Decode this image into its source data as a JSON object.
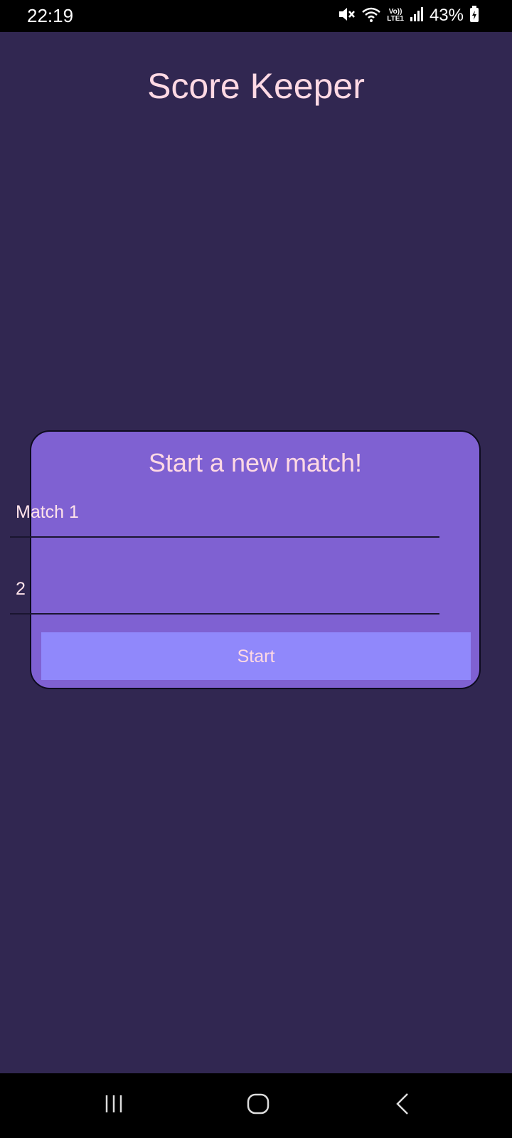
{
  "status_bar": {
    "time": "22:19",
    "battery_percent": "43%",
    "icons": [
      "mute-icon",
      "wifi-icon",
      "volte-lte-icon",
      "signal-icon",
      "battery-charging-icon"
    ],
    "volte_label": "Vo))",
    "lte_label": "LTE1"
  },
  "app": {
    "title": "Score Keeper"
  },
  "new_match_card": {
    "title": "Start a new match!",
    "match_name_value": "Match 1",
    "players_value": "2",
    "start_label": "Start"
  },
  "colors": {
    "background": "#312751",
    "card": "#7f61d2",
    "button": "#9088fb",
    "text_pink": "#ffd9e4"
  },
  "nav_bar": {
    "icons": [
      "recent-apps-icon",
      "home-icon",
      "back-icon"
    ]
  }
}
